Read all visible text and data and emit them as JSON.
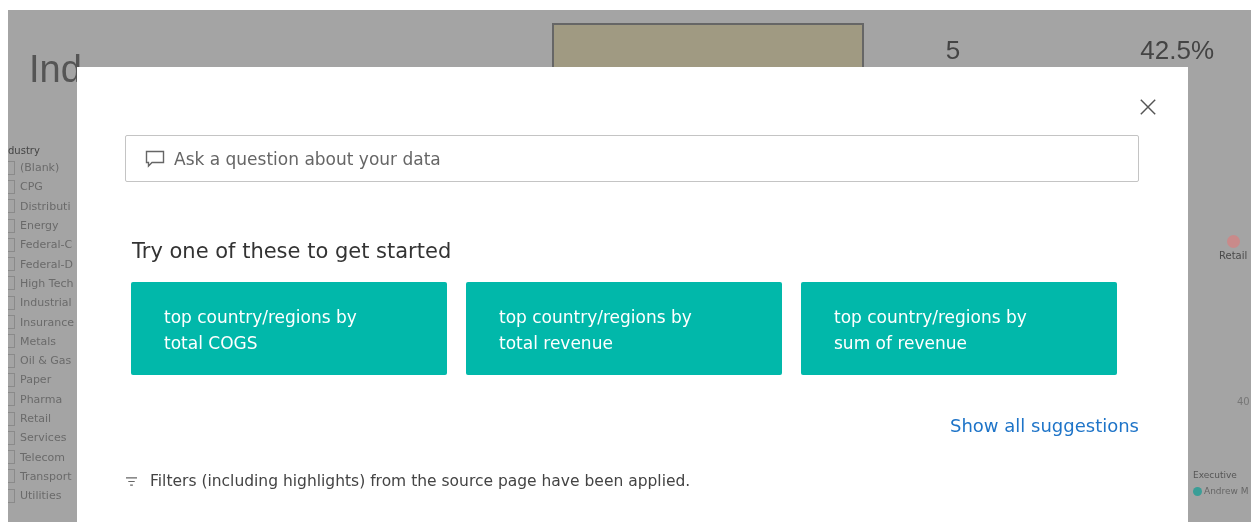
{
  "report": {
    "title": "Ind",
    "card_values": [
      "5",
      "42.5%"
    ],
    "slicer": {
      "header": "dustry",
      "items": [
        {
          "label": "(Blank)",
          "checked": false
        },
        {
          "label": "CPG",
          "checked": false
        },
        {
          "label": "Distributi",
          "checked": false
        },
        {
          "label": "Energy",
          "checked": false
        },
        {
          "label": "Federal-C",
          "checked": false
        },
        {
          "label": "Federal-D",
          "checked": false
        },
        {
          "label": "High Tech",
          "checked": false
        },
        {
          "label": "Industrial",
          "checked": false
        },
        {
          "label": "Insurance",
          "checked": false
        },
        {
          "label": "Metals",
          "checked": false
        },
        {
          "label": "Oil & Gas",
          "checked": false
        },
        {
          "label": "Paper",
          "checked": false
        },
        {
          "label": "Pharma",
          "checked": false
        },
        {
          "label": "Retail",
          "checked": false
        },
        {
          "label": "Services",
          "checked": false
        },
        {
          "label": "Telecom",
          "checked": false
        },
        {
          "label": "Transport",
          "checked": false
        },
        {
          "label": "Utilities",
          "checked": false
        }
      ]
    },
    "chart": {
      "point_label": "Retail",
      "axis_label": "40",
      "legend_title": "Executive",
      "legend": [
        {
          "label": "Andrew M",
          "color": "#3a9e97"
        }
      ]
    }
  },
  "dialog": {
    "question_field": {
      "placeholder": "Ask a question about your data"
    },
    "heading": "Try one of these to get started",
    "suggestions": [
      "top country/regions by total COGS",
      "top country/regions by total revenue",
      "top country/regions by sum of revenue"
    ],
    "show_all": "Show all suggestions",
    "filter_note": "Filters (including highlights) from the source page have been applied."
  }
}
